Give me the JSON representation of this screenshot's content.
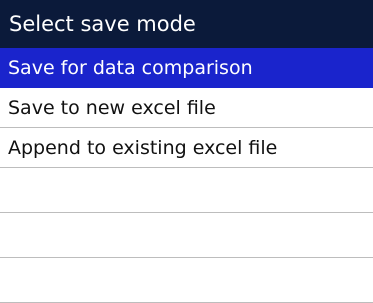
{
  "dialog": {
    "title": "Select save mode"
  },
  "menu": {
    "items": [
      {
        "label": "Save for data comparison",
        "selected": true
      },
      {
        "label": "Save to new excel file",
        "selected": false
      },
      {
        "label": "Append to existing excel file",
        "selected": false
      }
    ]
  },
  "colors": {
    "title_bar_bg": "#0b1a3a",
    "selected_bg": "#1a24cc",
    "selected_text": "#ffffff",
    "text": "#111111",
    "divider": "#bdbdbd"
  }
}
